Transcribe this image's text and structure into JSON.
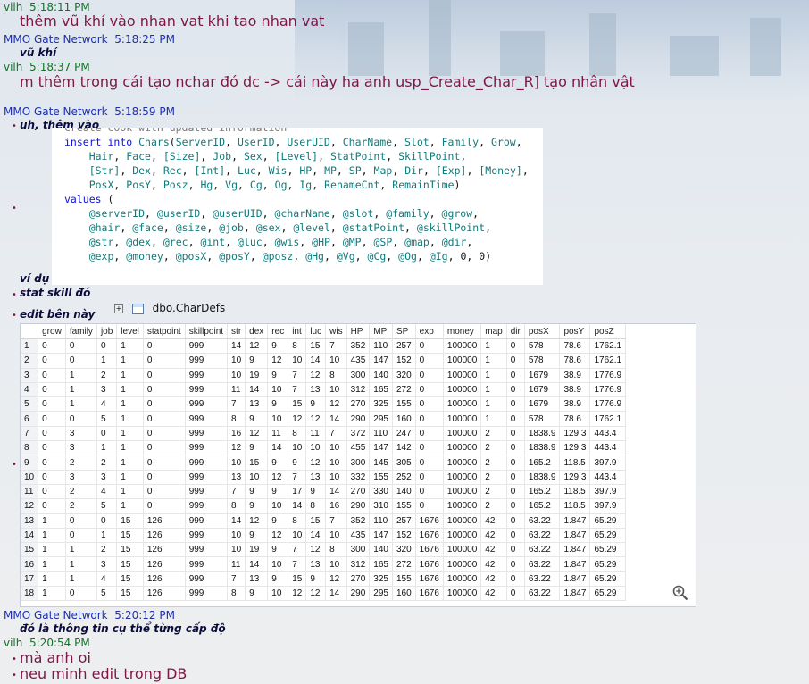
{
  "chat": {
    "m1": {
      "sender": "vilh",
      "time": "5:18:11 PM",
      "text": "thêm vũ khí vào nhan vat khi tao nhan vat"
    },
    "m2": {
      "sender": "MMO Gate Network",
      "time": "5:18:25 PM",
      "text": "vũ khí"
    },
    "m3": {
      "sender": "vilh",
      "time": "5:18:37 PM",
      "text": "m thêm trong cái tạo nchar đó dc -> cái này ha anh usp_Create_Char_R] tạo nhân vật"
    },
    "m4": {
      "sender": "MMO Gate Network",
      "time": "5:18:59 PM",
      "text": "uh, thêm vào"
    },
    "m4b": "ví dụ",
    "m4c": "stat skill đó",
    "m4d": "edit bên này",
    "m5": {
      "sender": "MMO Gate Network",
      "time": "5:20:12 PM",
      "text": "đó là thông tin cụ thể từng cấp độ"
    },
    "m6": {
      "sender": "vilh",
      "time": "5:20:54 PM",
      "lines": [
        "mà anh oi",
        "neu minh edit trong DB"
      ]
    }
  },
  "code": {
    "partial_top": "create cook with updated information",
    "lines": [
      "insert into Chars(ServerID, UserID, UserUID, CharName, Slot, Family, Grow,",
      "    Hair, Face, [Size], Job, Sex, [Level], StatPoint, SkillPoint,",
      "    [Str], Dex, Rec, [Int], Luc, Wis, HP, MP, SP, Map, Dir, [Exp], [Money],",
      "    PosX, PosY, Posz, Hg, Vg, Cg, Og, Ig, RenameCnt, RemainTime)",
      "values (",
      "    @serverID, @userID, @userUID, @charName, @slot, @family, @grow,",
      "    @hair, @face, @size, @job, @sex, @level, @statPoint, @skillPoint,",
      "    @str, @dex, @rec, @int, @luc, @wis, @HP, @MP, @SP, @map, @dir,",
      "    @exp, @money, @posX, @posY, @posz, @Hg, @Vg, @Cg, @Og, @Ig, 0, 0)"
    ]
  },
  "grid": {
    "tab_label": "dbo.CharDefs",
    "columns": [
      "",
      "grow",
      "family",
      "job",
      "level",
      "statpoint",
      "skillpoint",
      "str",
      "dex",
      "rec",
      "int",
      "luc",
      "wis",
      "HP",
      "MP",
      "SP",
      "exp",
      "money",
      "map",
      "dir",
      "posX",
      "posY",
      "posZ"
    ],
    "rows": [
      [
        "1",
        "0",
        "0",
        "0",
        "1",
        "0",
        "999",
        "14",
        "12",
        "9",
        "8",
        "15",
        "7",
        "352",
        "110",
        "257",
        "0",
        "100000",
        "1",
        "0",
        "578",
        "78.6",
        "1762.1"
      ],
      [
        "2",
        "0",
        "0",
        "1",
        "1",
        "0",
        "999",
        "10",
        "9",
        "12",
        "10",
        "14",
        "10",
        "435",
        "147",
        "152",
        "0",
        "100000",
        "1",
        "0",
        "578",
        "78.6",
        "1762.1"
      ],
      [
        "3",
        "0",
        "1",
        "2",
        "1",
        "0",
        "999",
        "10",
        "19",
        "9",
        "7",
        "12",
        "8",
        "300",
        "140",
        "320",
        "0",
        "100000",
        "1",
        "0",
        "1679",
        "38.9",
        "1776.9"
      ],
      [
        "4",
        "0",
        "1",
        "3",
        "1",
        "0",
        "999",
        "11",
        "14",
        "10",
        "7",
        "13",
        "10",
        "312",
        "165",
        "272",
        "0",
        "100000",
        "1",
        "0",
        "1679",
        "38.9",
        "1776.9"
      ],
      [
        "5",
        "0",
        "1",
        "4",
        "1",
        "0",
        "999",
        "7",
        "13",
        "9",
        "15",
        "9",
        "12",
        "270",
        "325",
        "155",
        "0",
        "100000",
        "1",
        "0",
        "1679",
        "38.9",
        "1776.9"
      ],
      [
        "6",
        "0",
        "0",
        "5",
        "1",
        "0",
        "999",
        "8",
        "9",
        "10",
        "12",
        "12",
        "14",
        "290",
        "295",
        "160",
        "0",
        "100000",
        "1",
        "0",
        "578",
        "78.6",
        "1762.1"
      ],
      [
        "7",
        "0",
        "3",
        "0",
        "1",
        "0",
        "999",
        "16",
        "12",
        "11",
        "8",
        "11",
        "7",
        "372",
        "110",
        "247",
        "0",
        "100000",
        "2",
        "0",
        "1838.9",
        "129.3",
        "443.4"
      ],
      [
        "8",
        "0",
        "3",
        "1",
        "1",
        "0",
        "999",
        "12",
        "9",
        "14",
        "10",
        "10",
        "10",
        "455",
        "147",
        "142",
        "0",
        "100000",
        "2",
        "0",
        "1838.9",
        "129.3",
        "443.4"
      ],
      [
        "9",
        "0",
        "2",
        "2",
        "1",
        "0",
        "999",
        "10",
        "15",
        "9",
        "9",
        "12",
        "10",
        "300",
        "145",
        "305",
        "0",
        "100000",
        "2",
        "0",
        "165.2",
        "118.5",
        "397.9"
      ],
      [
        "10",
        "0",
        "3",
        "3",
        "1",
        "0",
        "999",
        "13",
        "10",
        "12",
        "7",
        "13",
        "10",
        "332",
        "155",
        "252",
        "0",
        "100000",
        "2",
        "0",
        "1838.9",
        "129.3",
        "443.4"
      ],
      [
        "11",
        "0",
        "2",
        "4",
        "1",
        "0",
        "999",
        "7",
        "9",
        "9",
        "17",
        "9",
        "14",
        "270",
        "330",
        "140",
        "0",
        "100000",
        "2",
        "0",
        "165.2",
        "118.5",
        "397.9"
      ],
      [
        "12",
        "0",
        "2",
        "5",
        "1",
        "0",
        "999",
        "8",
        "9",
        "10",
        "14",
        "8",
        "16",
        "290",
        "310",
        "155",
        "0",
        "100000",
        "2",
        "0",
        "165.2",
        "118.5",
        "397.9"
      ],
      [
        "13",
        "1",
        "0",
        "0",
        "15",
        "126",
        "999",
        "14",
        "12",
        "9",
        "8",
        "15",
        "7",
        "352",
        "110",
        "257",
        "1676",
        "100000",
        "42",
        "0",
        "63.22",
        "1.847",
        "65.29"
      ],
      [
        "14",
        "1",
        "0",
        "1",
        "15",
        "126",
        "999",
        "10",
        "9",
        "12",
        "10",
        "14",
        "10",
        "435",
        "147",
        "152",
        "1676",
        "100000",
        "42",
        "0",
        "63.22",
        "1.847",
        "65.29"
      ],
      [
        "15",
        "1",
        "1",
        "2",
        "15",
        "126",
        "999",
        "10",
        "19",
        "9",
        "7",
        "12",
        "8",
        "300",
        "140",
        "320",
        "1676",
        "100000",
        "42",
        "0",
        "63.22",
        "1.847",
        "65.29"
      ],
      [
        "16",
        "1",
        "1",
        "3",
        "15",
        "126",
        "999",
        "11",
        "14",
        "10",
        "7",
        "13",
        "10",
        "312",
        "165",
        "272",
        "1676",
        "100000",
        "42",
        "0",
        "63.22",
        "1.847",
        "65.29"
      ],
      [
        "17",
        "1",
        "1",
        "4",
        "15",
        "126",
        "999",
        "7",
        "13",
        "9",
        "15",
        "9",
        "12",
        "270",
        "325",
        "155",
        "1676",
        "100000",
        "42",
        "0",
        "63.22",
        "1.847",
        "65.29"
      ],
      [
        "18",
        "1",
        "0",
        "5",
        "15",
        "126",
        "999",
        "8",
        "9",
        "10",
        "12",
        "12",
        "14",
        "290",
        "295",
        "160",
        "1676",
        "100000",
        "42",
        "0",
        "63.22",
        "1.847",
        "65.29"
      ]
    ]
  }
}
